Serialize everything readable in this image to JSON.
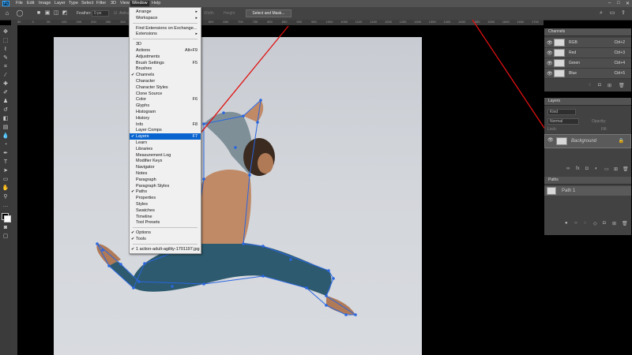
{
  "menubar": {
    "app_icon": "Ps",
    "items": [
      "File",
      "Edit",
      "Image",
      "Layer",
      "Type",
      "Select",
      "Filter",
      "3D",
      "View",
      "Window",
      "Help"
    ],
    "active": "Window"
  },
  "options_bar": {
    "feather_label": "Feather:",
    "feather_value": "0 px",
    "antialias_label": "Anti-alias",
    "width_label": "Width",
    "height_label": "Height",
    "select_mask_label": "Select and Mask..."
  },
  "ruler_ticks": [
    "50",
    "0",
    "50",
    "100",
    "150",
    "200",
    "250",
    "300",
    "350",
    "400",
    "450",
    "500",
    "550",
    "600",
    "650",
    "700",
    "750",
    "800",
    "850",
    "900",
    "950",
    "1000",
    "1050",
    "1100",
    "1150",
    "1200",
    "1250",
    "1300",
    "1350",
    "1400",
    "1450",
    "1500",
    "1550",
    "1600",
    "1650",
    "1700"
  ],
  "window_menu": {
    "items": [
      {
        "label": "Arrange",
        "submenu": true
      },
      {
        "label": "Workspace",
        "submenu": true
      },
      {
        "sep": true
      },
      {
        "label": "Find Extensions on Exchange..."
      },
      {
        "label": "Extensions",
        "submenu": true
      },
      {
        "sep": true
      },
      {
        "label": "3D"
      },
      {
        "label": "Actions",
        "shortcut": "Alt+F9"
      },
      {
        "label": "Adjustments"
      },
      {
        "label": "Brush Settings",
        "shortcut": "F5"
      },
      {
        "label": "Brushes"
      },
      {
        "label": "Channels",
        "checked": true
      },
      {
        "label": "Character"
      },
      {
        "label": "Character Styles"
      },
      {
        "label": "Clone Source"
      },
      {
        "label": "Color",
        "shortcut": "F6"
      },
      {
        "label": "Glyphs"
      },
      {
        "label": "Histogram"
      },
      {
        "label": "History"
      },
      {
        "label": "Info",
        "shortcut": "F8"
      },
      {
        "label": "Layer Comps"
      },
      {
        "label": "Layers",
        "shortcut": "F7",
        "checked": true,
        "highlighted": true
      },
      {
        "label": "Learn"
      },
      {
        "label": "Libraries"
      },
      {
        "label": "Measurement Log"
      },
      {
        "label": "Modifier Keys"
      },
      {
        "label": "Navigator"
      },
      {
        "label": "Notes"
      },
      {
        "label": "Paragraph"
      },
      {
        "label": "Paragraph Styles"
      },
      {
        "label": "Paths",
        "checked": true
      },
      {
        "label": "Properties"
      },
      {
        "label": "Styles"
      },
      {
        "label": "Swatches"
      },
      {
        "label": "Timeline"
      },
      {
        "label": "Tool Presets"
      },
      {
        "sep": true
      },
      {
        "label": "Options",
        "checked": true
      },
      {
        "label": "Tools",
        "checked": true
      },
      {
        "sep": true
      },
      {
        "label": "1 action-adult-agility-1701197.jpg",
        "checked": true
      }
    ]
  },
  "channels_panel": {
    "title": "Channels",
    "rows": [
      {
        "name": "RGB",
        "shortcut": "Ctrl+2"
      },
      {
        "name": "Red",
        "shortcut": "Ctrl+3"
      },
      {
        "name": "Green",
        "shortcut": "Ctrl+4"
      },
      {
        "name": "Blue",
        "shortcut": "Ctrl+5"
      }
    ]
  },
  "layers_panel": {
    "title": "Layers",
    "kind_label": "Kind",
    "blend_mode": "Normal",
    "opacity_label": "Opacity:",
    "lock_label": "Lock:",
    "fill_label": "Fill:",
    "layer_name": "Background"
  },
  "paths_panel": {
    "title": "Paths",
    "path_name": "Path 1"
  },
  "colors": {
    "menu_highlight": "#0a64d0",
    "annotation_arrow": "#e01010",
    "path_anchor": "#2a66e0"
  }
}
